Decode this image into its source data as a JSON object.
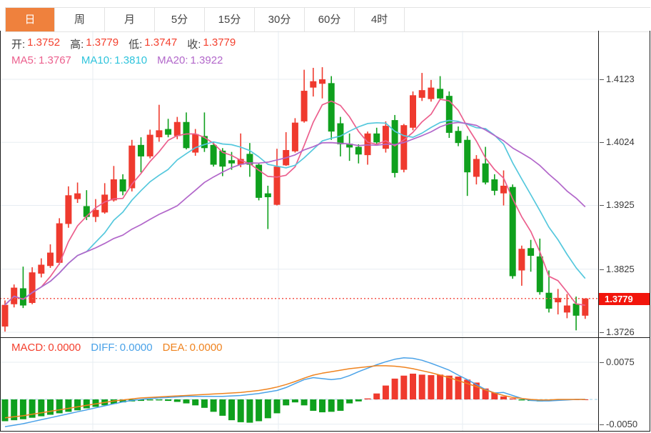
{
  "tabs": {
    "items": [
      {
        "label": "日",
        "active": true
      },
      {
        "label": "周",
        "active": false
      },
      {
        "label": "月",
        "active": false
      },
      {
        "label": "5分",
        "active": false
      },
      {
        "label": "15分",
        "active": false
      },
      {
        "label": "30分",
        "active": false
      },
      {
        "label": "60分",
        "active": false
      },
      {
        "label": "4时",
        "active": false
      }
    ]
  },
  "quote": {
    "open_label": "开:",
    "open": "1.3752",
    "high_label": "高:",
    "high": "1.3779",
    "low_label": "低:",
    "low": "1.3747",
    "close_label": "收:",
    "close": "1.3779"
  },
  "ma_readout": {
    "ma5_label": "MA5:",
    "ma5": "1.3767",
    "ma10_label": "MA10:",
    "ma10": "1.3810",
    "ma20_label": "MA20:",
    "ma20": "1.3922"
  },
  "macd_readout": {
    "macd_label": "MACD:",
    "macd": "0.0000",
    "diff_label": "DIFF:",
    "diff": "0.0000",
    "dea_label": "DEA:",
    "dea": "0.0000"
  },
  "price_axis": {
    "ticks": [
      "1.4123",
      "1.4024",
      "1.3925",
      "1.3825",
      "1.3726"
    ],
    "current": "1.3779"
  },
  "macd_axis": {
    "ticks": [
      "0.0075",
      "-0.0050"
    ]
  },
  "colors": {
    "up": "#ef3a2e",
    "down": "#0fa01d",
    "ma5": "#ec5f8d",
    "ma10": "#55c8dd",
    "ma20": "#b267ca",
    "diff": "#4aa2e8",
    "dea": "#ef831f",
    "current_line": "#f4574d",
    "badge_bg": "#f2150c",
    "tab_active": "#ef813d",
    "grid": "#e7edf2",
    "zero_dash": "#9fd0e8"
  },
  "chart_data": {
    "type": "candlestick",
    "timeframe": "日",
    "title": "",
    "price_axis_ticks": [
      1.4123,
      1.4024,
      1.3925,
      1.3825,
      1.3726
    ],
    "current_price": 1.3779,
    "ohlc_last": {
      "open": 1.3752,
      "high": 1.3779,
      "low": 1.3747,
      "close": 1.3779
    },
    "ma_values": {
      "ma5": 1.3767,
      "ma10": 1.381,
      "ma20": 1.3922
    },
    "ma_periods": [
      5,
      10,
      20
    ],
    "grid": true,
    "candles_ohlc": [
      [
        1.3735,
        1.3776,
        1.3727,
        1.3769
      ],
      [
        1.377,
        1.3801,
        1.3765,
        1.3796
      ],
      [
        1.3795,
        1.3829,
        1.3764,
        1.3768
      ],
      [
        1.3772,
        1.3828,
        1.377,
        1.382
      ],
      [
        1.3818,
        1.3842,
        1.3812,
        1.3832
      ],
      [
        1.383,
        1.3864,
        1.3827,
        1.3851
      ],
      [
        1.3835,
        1.3905,
        1.3832,
        1.3897
      ],
      [
        1.3896,
        1.3955,
        1.389,
        1.3941
      ],
      [
        1.3935,
        1.3961,
        1.3929,
        1.3944
      ],
      [
        1.3924,
        1.3949,
        1.3902,
        1.3907
      ],
      [
        1.3907,
        1.3935,
        1.3899,
        1.3918
      ],
      [
        1.3914,
        1.396,
        1.3912,
        1.3942
      ],
      [
        1.3933,
        1.3987,
        1.3931,
        1.3966
      ],
      [
        1.3966,
        1.3974,
        1.3941,
        1.3947
      ],
      [
        1.3952,
        1.4028,
        1.3947,
        1.4019
      ],
      [
        1.402,
        1.4032,
        1.3977,
        1.4002
      ],
      [
        1.4002,
        1.4044,
        1.3999,
        1.4036
      ],
      [
        1.4032,
        1.4083,
        1.4025,
        1.4043
      ],
      [
        1.4045,
        1.4061,
        1.4032,
        1.4036
      ],
      [
        1.4034,
        1.4064,
        1.4029,
        1.4056
      ],
      [
        1.4056,
        1.4071,
        1.4013,
        1.4015
      ],
      [
        1.4008,
        1.4045,
        1.4003,
        1.4037
      ],
      [
        1.4034,
        1.4071,
        1.4009,
        1.4015
      ],
      [
        1.402,
        1.4025,
        1.3986,
        1.3989
      ],
      [
        1.4011,
        1.4015,
        1.3971,
        1.3986
      ],
      [
        1.3996,
        1.4009,
        1.3981,
        1.3991
      ],
      [
        1.3989,
        1.4038,
        1.3985,
        1.3998
      ],
      [
        1.4006,
        1.4023,
        1.397,
        1.3989
      ],
      [
        1.3989,
        1.3992,
        1.3933,
        1.3937
      ],
      [
        1.3944,
        1.3956,
        1.3888,
        1.3938
      ],
      [
        1.3926,
        1.4014,
        1.3925,
        1.3986
      ],
      [
        1.3988,
        1.404,
        1.3987,
        1.4012
      ],
      [
        1.401,
        1.4062,
        1.4008,
        1.4055
      ],
      [
        1.4057,
        1.4138,
        1.4055,
        1.4105
      ],
      [
        1.411,
        1.4141,
        1.4096,
        1.412
      ],
      [
        1.4116,
        1.4142,
        1.4093,
        1.4123
      ],
      [
        1.4117,
        1.4128,
        1.4028,
        1.4041
      ],
      [
        1.4054,
        1.4064,
        1.4002,
        1.4021
      ],
      [
        1.4022,
        1.4038,
        1.3995,
        1.4016
      ],
      [
        1.4017,
        1.4021,
        1.3991,
        1.4005
      ],
      [
        1.4004,
        1.4041,
        1.3989,
        1.4038
      ],
      [
        1.4038,
        1.4047,
        1.402,
        1.4024
      ],
      [
        1.4014,
        1.4057,
        1.4008,
        1.405
      ],
      [
        1.4059,
        1.4067,
        1.3969,
        1.3976
      ],
      [
        1.3981,
        1.4053,
        1.3977,
        1.4051
      ],
      [
        1.4047,
        1.4104,
        1.4043,
        1.4098
      ],
      [
        1.4094,
        1.4133,
        1.4089,
        1.4106
      ],
      [
        1.4092,
        1.4122,
        1.4088,
        1.411
      ],
      [
        1.4108,
        1.4128,
        1.4091,
        1.4093
      ],
      [
        1.4097,
        1.4104,
        1.4031,
        1.4039
      ],
      [
        1.4042,
        1.4049,
        1.4018,
        1.4023
      ],
      [
        1.4028,
        1.4034,
        1.394,
        1.3977
      ],
      [
        1.397,
        1.4004,
        1.3958,
        1.3998
      ],
      [
        1.3991,
        1.4017,
        1.3958,
        1.3961
      ],
      [
        1.3966,
        1.3974,
        1.3941,
        1.3948
      ],
      [
        1.3944,
        1.398,
        1.3925,
        1.3956
      ],
      [
        1.3954,
        1.3958,
        1.381,
        1.3814
      ],
      [
        1.3823,
        1.3862,
        1.3799,
        1.3857
      ],
      [
        1.3858,
        1.3871,
        1.3821,
        1.3846
      ],
      [
        1.3845,
        1.3873,
        1.3785,
        1.3789
      ],
      [
        1.3788,
        1.3823,
        1.3757,
        1.3763
      ],
      [
        1.3773,
        1.3794,
        1.3754,
        1.378
      ],
      [
        1.3757,
        1.3786,
        1.3748,
        1.3768
      ],
      [
        1.3771,
        1.3782,
        1.3729,
        1.3752
      ],
      [
        1.3752,
        1.3779,
        1.3747,
        1.3779
      ]
    ],
    "macd": {
      "axis_ticks": [
        0.0075,
        -0.005
      ],
      "macd_last": 0.0,
      "diff_last": 0.0,
      "dea_last": 0.0,
      "histogram": [
        -0.0044,
        -0.0042,
        -0.004,
        -0.0037,
        -0.0034,
        -0.0031,
        -0.0028,
        -0.0025,
        -0.0022,
        -0.0018,
        -0.0015,
        -0.0012,
        -0.0009,
        -0.0006,
        -0.0004,
        -0.0003,
        -0.0002,
        -0.0002,
        -0.0003,
        -0.0005,
        -0.0008,
        -0.0012,
        -0.0017,
        -0.0025,
        -0.0033,
        -0.0042,
        -0.0046,
        -0.0047,
        -0.0044,
        -0.0038,
        -0.0028,
        -0.0012,
        -0.0006,
        -0.0012,
        -0.0023,
        -0.0026,
        -0.0025,
        -0.0023,
        -0.0008,
        -0.0004,
        0.0002,
        0.0012,
        0.0028,
        0.0042,
        0.0048,
        0.0052,
        0.005,
        0.0049,
        0.005,
        0.0048,
        0.0046,
        0.004,
        0.0034,
        0.0022,
        0.0014,
        0.0006,
        0.0002,
        -0.0002,
        -0.0003,
        -0.0004,
        -0.0003,
        -0.0002,
        -0.0001,
        0.0,
        0.0
      ],
      "diff_line": [
        -0.0055,
        -0.0052,
        -0.0049,
        -0.0045,
        -0.0041,
        -0.0037,
        -0.0033,
        -0.0029,
        -0.0025,
        -0.0021,
        -0.0017,
        -0.0013,
        -0.0009,
        -0.0005,
        -0.0002,
        0.0,
        0.0002,
        0.0003,
        0.0004,
        0.0005,
        0.0006,
        0.0006,
        0.0006,
        0.0006,
        0.0006,
        0.0007,
        0.0008,
        0.001,
        0.0012,
        0.0015,
        0.0018,
        0.0024,
        0.0032,
        0.004,
        0.0044,
        0.0042,
        0.004,
        0.0042,
        0.0048,
        0.0056,
        0.0063,
        0.007,
        0.0076,
        0.0081,
        0.0084,
        0.0083,
        0.0079,
        0.0073,
        0.0066,
        0.0059,
        0.0049,
        0.004,
        0.003,
        0.002,
        0.0013,
        0.0014,
        0.0008,
        0.0002,
        -0.0002,
        -0.0003,
        -0.0003,
        -0.0002,
        -0.0001,
        0.0,
        0.0
      ],
      "dea_line": [
        -0.0037,
        -0.0035,
        -0.0033,
        -0.003,
        -0.0027,
        -0.0024,
        -0.0021,
        -0.0018,
        -0.0015,
        -0.0012,
        -0.0009,
        -0.0006,
        -0.0003,
        -0.0001,
        0.0001,
        0.0003,
        0.0004,
        0.0005,
        0.0006,
        0.0007,
        0.0008,
        0.0009,
        0.001,
        0.0011,
        0.0012,
        0.0013,
        0.0014,
        0.0016,
        0.0018,
        0.0021,
        0.0025,
        0.003,
        0.0036,
        0.0043,
        0.0049,
        0.0053,
        0.0056,
        0.0059,
        0.0062,
        0.0064,
        0.0066,
        0.0068,
        0.0068,
        0.0067,
        0.0065,
        0.0062,
        0.0058,
        0.0054,
        0.0049,
        0.0044,
        0.0038,
        0.0032,
        0.0026,
        0.0019,
        0.0013,
        0.0008,
        0.0004,
        0.0002,
        0.0,
        -0.0001,
        -0.0001,
        0.0,
        0.0,
        0.0,
        0.0
      ]
    }
  }
}
